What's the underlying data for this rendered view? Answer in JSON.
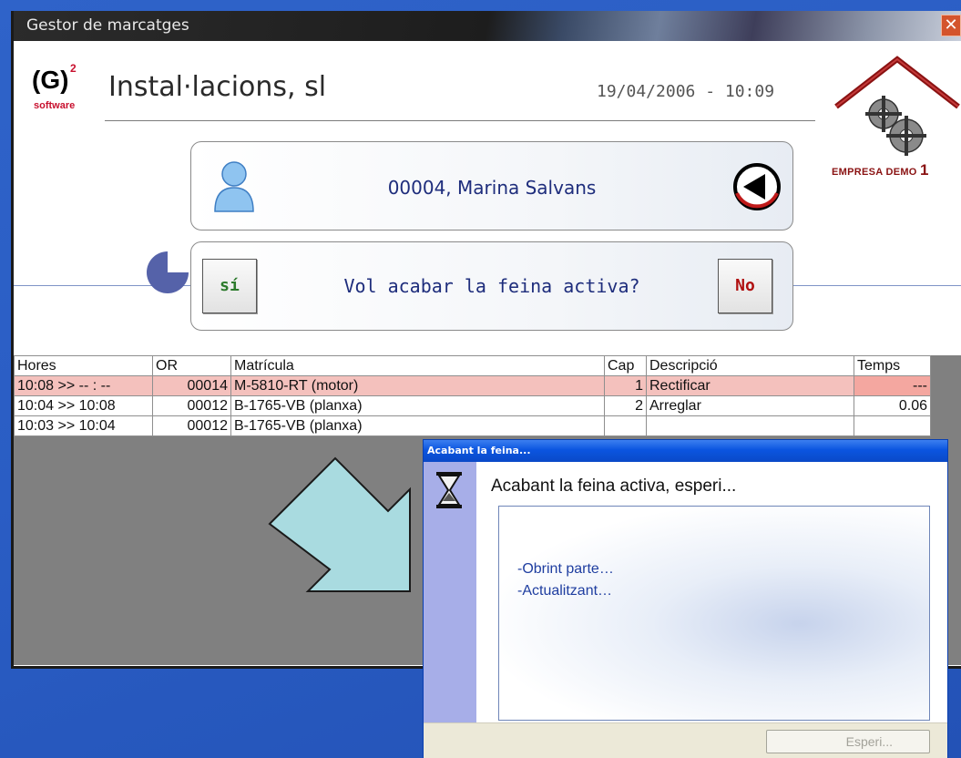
{
  "window": {
    "title": "Gestor de marcatges",
    "close_glyph": "✕"
  },
  "header": {
    "logo_main": "(G)",
    "logo_superscript": "2",
    "logo_sub": "software",
    "company": "Instal·lacions, sl",
    "datetime": "19/04/2006 - 10:09",
    "brand_label": "EMPRESA DEMO",
    "brand_number": "1"
  },
  "employee": {
    "name": "00004, Marina Salvans",
    "icon": "user-icon",
    "back_icon": "back-arrow-icon"
  },
  "question": {
    "yes_label": "sí",
    "no_label": "No",
    "text": "Vol acabar la feina activa?"
  },
  "table": {
    "columns": [
      "Hores",
      "OR",
      "Matrícula",
      "Cap",
      "Descripció",
      "Temps"
    ],
    "rows": [
      {
        "hores": "10:08 >> -- : --",
        "or": "00014",
        "matricula": "M-5810-RT (motor)",
        "cap": "1",
        "descripcio": "Rectificar",
        "temps": "---"
      },
      {
        "hores": "10:04 >> 10:08",
        "or": "00012",
        "matricula": "B-1765-VB (planxa)",
        "cap": "2",
        "descripcio": "Arreglar",
        "temps": "0.06"
      },
      {
        "hores": "10:03 >> 10:04",
        "or": "00012",
        "matricula": "B-1765-VB (planxa)",
        "cap": "",
        "descripcio": "",
        "temps": ""
      }
    ]
  },
  "dialog": {
    "title": "Acabant la feina...",
    "heading": "Acabant la feina activa, esperi...",
    "status_lines": [
      "-Obrint parte…",
      "-Actualitzant…"
    ],
    "button_label": "Esperi..."
  },
  "colors": {
    "desktop": "#2a5dc4",
    "active_row": "#f4c1bd",
    "accent_text": "#1e2d7c",
    "yes_green": "#2c7a2c",
    "no_red": "#b01010"
  }
}
